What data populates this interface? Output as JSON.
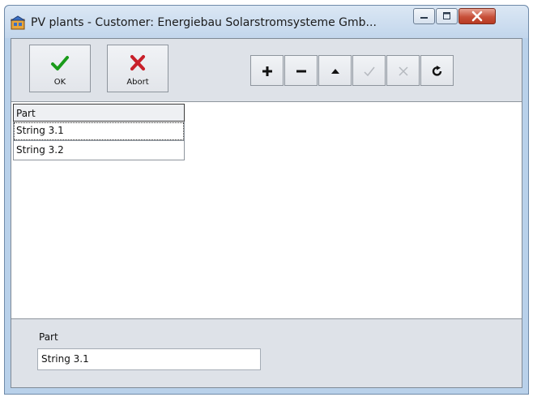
{
  "window": {
    "title": "PV plants - Customer: Energiebau Solarstromsysteme Gmb...",
    "controls": {
      "minimize_icon": "minimize-icon",
      "maximize_icon": "maximize-icon",
      "close_icon": "close-icon"
    }
  },
  "toolbar": {
    "ok_label": "OK",
    "abort_label": "Abort",
    "buttons": [
      {
        "icon": "plus-icon",
        "enabled": true
      },
      {
        "icon": "minus-icon",
        "enabled": true
      },
      {
        "icon": "up-triangle-icon",
        "enabled": true
      },
      {
        "icon": "check-icon",
        "enabled": false
      },
      {
        "icon": "cancel-x-icon",
        "enabled": false
      },
      {
        "icon": "refresh-icon",
        "enabled": true
      }
    ]
  },
  "grid": {
    "header": "Part",
    "rows": [
      "String 3.1",
      "String 3.2"
    ],
    "selected_index": 0
  },
  "detail": {
    "label": "Part",
    "value": "String 3.1"
  },
  "colors": {
    "ok_green": "#1a9b1a",
    "abort_red": "#c8202a",
    "close_red": "#c7503a"
  }
}
